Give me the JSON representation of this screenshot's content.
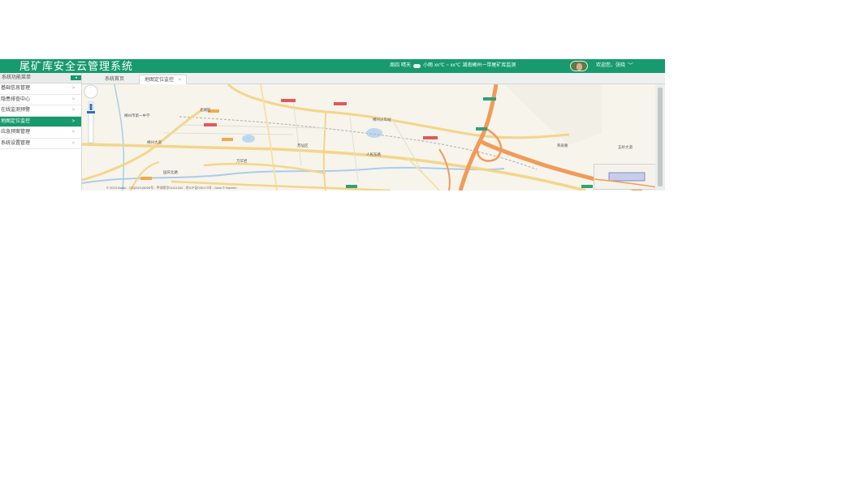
{
  "app_title": "尾矿库安全云管理系统",
  "weather": {
    "date": "周四",
    "day": "晴天",
    "icon": "cloud-icon",
    "temp_label": "小雨",
    "temp_range": "xx℃ ~ xx℃",
    "location": "湖南郴州一带尾矿库监测"
  },
  "user": {
    "greeting": "欢迎您，张晓",
    "menu_icon": "chevron-down-icon"
  },
  "sidebar": {
    "header_label": "系统功能菜单",
    "toggle_label": "◂",
    "items": [
      {
        "label": "基础信息管理",
        "arrow": ">",
        "active": false
      },
      {
        "label": "隐患排查中心",
        "arrow": ">",
        "active": false
      },
      {
        "label": "在线监测预警",
        "arrow": ">",
        "active": false
      },
      {
        "label": "地图定位监控",
        "arrow": ">",
        "active": true
      },
      {
        "label": "应急预案管理",
        "arrow": ">",
        "active": false
      },
      {
        "label": "系统设置管理",
        "arrow": ">",
        "active": false
      }
    ]
  },
  "tabs": [
    {
      "label": "系统首页",
      "active": false
    },
    {
      "label": "地图定位监控",
      "active": true,
      "close": "×"
    }
  ],
  "map": {
    "attribution": "© 2023 Baidu - GS(2021)6026号 - 甲测资字11111342 - 京ICP证030173号 - Data © Navinfo",
    "labels": [
      "郴州市第一中学",
      "北湖区",
      "苏仙区",
      "郴州火车站",
      "万华岩",
      "郴州大道",
      "人民东路",
      "国庆北路",
      "燕泉路",
      "五岭大道"
    ]
  },
  "colors": {
    "primary": "#169a6e",
    "highway": "#f29a58",
    "road": "#f4d58a",
    "water": "#a9cdee"
  }
}
